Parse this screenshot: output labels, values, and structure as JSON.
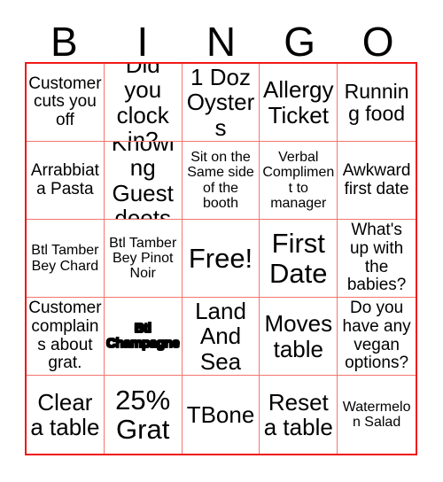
{
  "colors": {
    "grid_outer_border": "#f01818",
    "grid_inner_border": "#f4756f",
    "text": "#000000",
    "background": "#ffffff"
  },
  "header": {
    "letters": [
      "B",
      "I",
      "N",
      "G",
      "O"
    ]
  },
  "board": {
    "rows": 5,
    "columns": 5,
    "cells": [
      {
        "text": "Customer cuts you off",
        "size": "fs-md",
        "marked": false
      },
      {
        "text": "Did you clock in?",
        "size": "fs-xl",
        "marked": false
      },
      {
        "text": "1 Doz Oysters",
        "size": "fs-xl",
        "marked": false
      },
      {
        "text": "Allergy Ticket",
        "size": "fs-xl",
        "marked": false
      },
      {
        "text": "Running food",
        "size": "fs-lg",
        "marked": false
      },
      {
        "text": "Arrabbiata Pasta",
        "size": "fs-md",
        "marked": false
      },
      {
        "text": "Knowing Guest deets",
        "size": "fs-xl",
        "marked": false
      },
      {
        "text": "Sit on the Same side of the booth",
        "size": "fs-sm",
        "marked": false
      },
      {
        "text": "Verbal Compliment to manager",
        "size": "fs-sm",
        "marked": false
      },
      {
        "text": "Awkward first date",
        "size": "fs-md",
        "marked": false
      },
      {
        "text": "Btl Tamber Bey Chard",
        "size": "fs-sm",
        "marked": false
      },
      {
        "text": "Btl Tamber Bey Pinot Noir",
        "size": "fs-sm",
        "marked": false
      },
      {
        "text": "Free!",
        "size": "fs-xxl",
        "marked": false
      },
      {
        "text": "First Date",
        "size": "fs-xxl",
        "marked": false
      },
      {
        "text": "What's up with the babies?",
        "size": "fs-md",
        "marked": false
      },
      {
        "text": "Customer complains about grat.",
        "size": "fs-md",
        "marked": false
      },
      {
        "text": "Btl Champagne",
        "size": "fs-sm",
        "marked": true
      },
      {
        "text": "Land And Sea",
        "size": "fs-xl",
        "marked": false
      },
      {
        "text": "Moves table",
        "size": "fs-xl",
        "marked": false
      },
      {
        "text": "Do you have any vegan options?",
        "size": "fs-md",
        "marked": false
      },
      {
        "text": "Clear a table",
        "size": "fs-xl",
        "marked": false
      },
      {
        "text": "25% Grat",
        "size": "fs-xxl",
        "marked": false
      },
      {
        "text": "TBone",
        "size": "fs-xl",
        "marked": false
      },
      {
        "text": "Reset a table",
        "size": "fs-xl",
        "marked": false
      },
      {
        "text": "Watermelon Salad",
        "size": "fs-sm",
        "marked": false
      }
    ]
  }
}
